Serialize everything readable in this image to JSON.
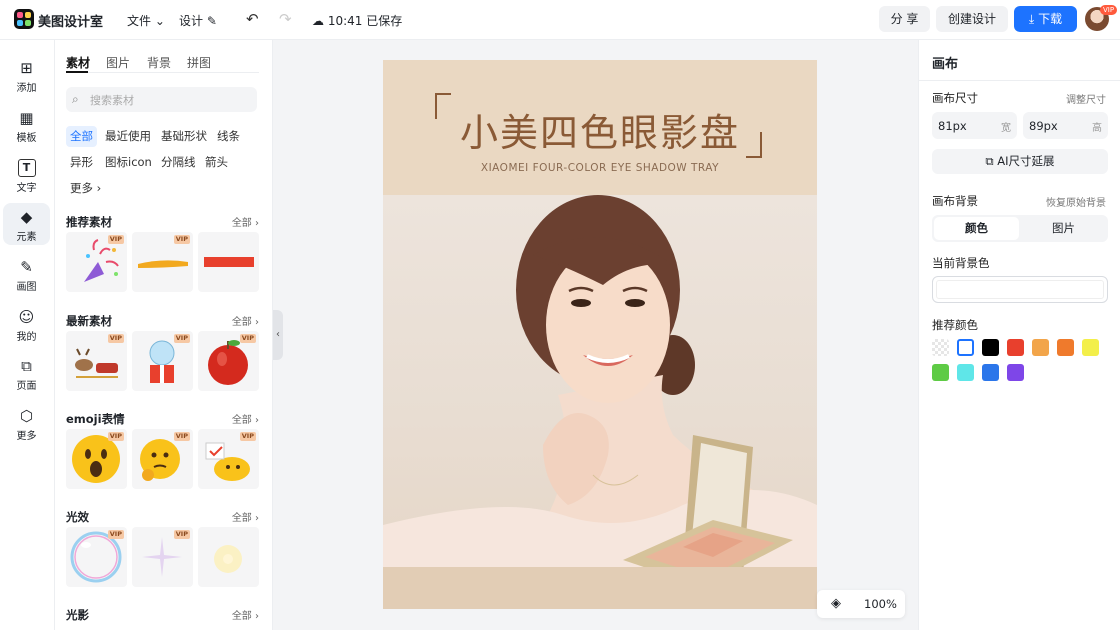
{
  "topbar": {
    "app_name": "美图设计室",
    "menu_file": "文件",
    "menu_design": "设计",
    "save_status": "10:41 已保存",
    "share": "分 享",
    "create": "创建设计",
    "download": "下载",
    "vip": "VIP"
  },
  "rail": {
    "items": [
      {
        "label": "添加",
        "icon": "plus-square-icon"
      },
      {
        "label": "模板",
        "icon": "template-icon"
      },
      {
        "label": "文字",
        "icon": "text-icon"
      },
      {
        "label": "元素",
        "icon": "elements-icon"
      },
      {
        "label": "画图",
        "icon": "draw-icon"
      },
      {
        "label": "我的",
        "icon": "user-icon"
      },
      {
        "label": "页面",
        "icon": "page-icon"
      },
      {
        "label": "更多",
        "icon": "more-cube-icon"
      }
    ]
  },
  "panel": {
    "tabs": [
      "素材",
      "图片",
      "背景",
      "拼图"
    ],
    "search_placeholder": "搜索素材",
    "chips": [
      "全部",
      "最近使用",
      "基础形状",
      "线条",
      "异形",
      "图标icon",
      "分隔线",
      "箭头",
      "更多"
    ],
    "all_label": "全部",
    "vip": "VIP",
    "sections": [
      "推荐素材",
      "最新素材",
      "emoji表情",
      "光效",
      "光影"
    ]
  },
  "canvas": {
    "headline": "小美四色眼影盘",
    "subline": "XIAOMEI FOUR-COLOR EYE SHADOW TRAY"
  },
  "zoom": {
    "value": "100%"
  },
  "right": {
    "title": "画布",
    "size_label": "画布尺寸",
    "adjust_size": "调整尺寸",
    "width_value": "81px",
    "width_unit": "宽",
    "height_value": "89px",
    "height_unit": "高",
    "ai_extend": "AI尺寸延展",
    "bg_label": "画布背景",
    "restore_bg": "恢复原始背景",
    "seg_color": "颜色",
    "seg_image": "图片",
    "current_bg": "当前背景色",
    "recommended": "推荐颜色",
    "swatches": [
      "transparent",
      "#ffffff",
      "#000000",
      "#e8402d",
      "#f2a54a",
      "#ef7a2c",
      "#f3ef4a",
      "#5ecb45",
      "#5fe6e8",
      "#2b76ea",
      "#7e46e8"
    ]
  },
  "colors": {
    "accent": "#1d73ff",
    "headline": "#8a5a36"
  }
}
